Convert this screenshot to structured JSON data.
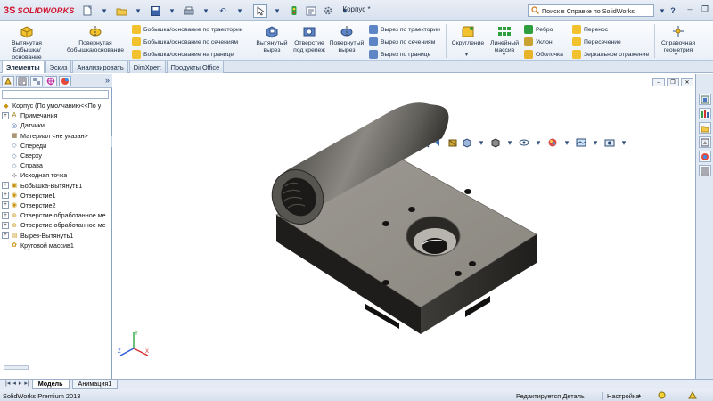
{
  "app": {
    "logo": "SOLIDWORKS",
    "logo_mark": "3S",
    "document_title": "Корпус *",
    "help_search_placeholder": "Поиск в Справке по SolidWorks"
  },
  "quick_access": {
    "icons": [
      "new-document-icon",
      "open-folder-icon",
      "save-icon",
      "print-icon",
      "undo-icon",
      "select-arrow-icon",
      "rebuild-icon",
      "file-properties-icon",
      "options-icon"
    ]
  },
  "ribbon": {
    "boss_extrude": "Вытянутая Бобышка/основание",
    "boss_revolve": "Повернутая бобышка/основание",
    "boss_sweep": "Бобышка/основание по траектории",
    "boss_loft": "Бобышка/основание по сечениям",
    "boss_boundary": "Бобышка/основание на границе",
    "cut_extrude": "Вытянутый вырез",
    "hole_wizard": "Отверстие под крепеж",
    "cut_revolve": "Повернутый вырез",
    "cut_sweep": "Вырез по траектории",
    "cut_loft": "Вырез по сечениям",
    "cut_boundary": "Вырез по границе",
    "fillet": "Скругление",
    "linear_pattern": "Линейный массив",
    "rib": "Ребро",
    "draft": "Уклон",
    "shell": "Оболочка",
    "wrap": "Перенос",
    "intersect": "Пересечение",
    "mirror": "Зеркальное отражение",
    "reference_geometry": "Справочная геометрия"
  },
  "command_tabs": [
    {
      "label": "Элементы",
      "active": true
    },
    {
      "label": "Эскиз",
      "active": false
    },
    {
      "label": "Анализировать",
      "active": false
    },
    {
      "label": "DimXpert",
      "active": false
    },
    {
      "label": "Продукты Office",
      "active": false
    }
  ],
  "feature_tree": [
    {
      "label": "Корпус  (По умолчанию<<По у",
      "icon": "part-icon",
      "indent": 0,
      "expander": ""
    },
    {
      "label": "Примечания",
      "icon": "annotations-icon",
      "indent": 1,
      "expander": "+"
    },
    {
      "label": "Датчики",
      "icon": "sensors-icon",
      "indent": 1,
      "expander": ""
    },
    {
      "label": "Материал <не указан>",
      "icon": "material-icon",
      "indent": 1,
      "expander": ""
    },
    {
      "label": "Спереди",
      "icon": "plane-icon",
      "indent": 1,
      "expander": ""
    },
    {
      "label": "Сверху",
      "icon": "plane-icon",
      "indent": 1,
      "expander": ""
    },
    {
      "label": "Справа",
      "icon": "plane-icon",
      "indent": 1,
      "expander": ""
    },
    {
      "label": "Исходная точка",
      "icon": "origin-icon",
      "indent": 1,
      "expander": ""
    },
    {
      "label": "Бобышка-Вытянуть1",
      "icon": "extrude-icon",
      "indent": 1,
      "expander": "+"
    },
    {
      "label": "Отверстие1",
      "icon": "hole-icon",
      "indent": 1,
      "expander": "+"
    },
    {
      "label": "Отверстие2",
      "icon": "hole-icon",
      "indent": 1,
      "expander": "+"
    },
    {
      "label": "Отверстие обработанное ме",
      "icon": "hole-wizard-icon",
      "indent": 1,
      "expander": "+"
    },
    {
      "label": "Отверстие обработанное ме",
      "icon": "hole-wizard-icon",
      "indent": 1,
      "expander": "+"
    },
    {
      "label": "Вырез-Вытянуть1",
      "icon": "cut-extrude-icon",
      "indent": 1,
      "expander": "+"
    },
    {
      "label": "Круговой массив1",
      "icon": "circular-pattern-icon",
      "indent": 1,
      "expander": ""
    }
  ],
  "model_tabs": [
    {
      "label": "Модель",
      "active": true
    },
    {
      "label": "Анимация1",
      "active": false
    }
  ],
  "status": {
    "app_name": "SolidWorks Premium 2013",
    "mode": "Редактируется Деталь",
    "units": "Настройка"
  }
}
